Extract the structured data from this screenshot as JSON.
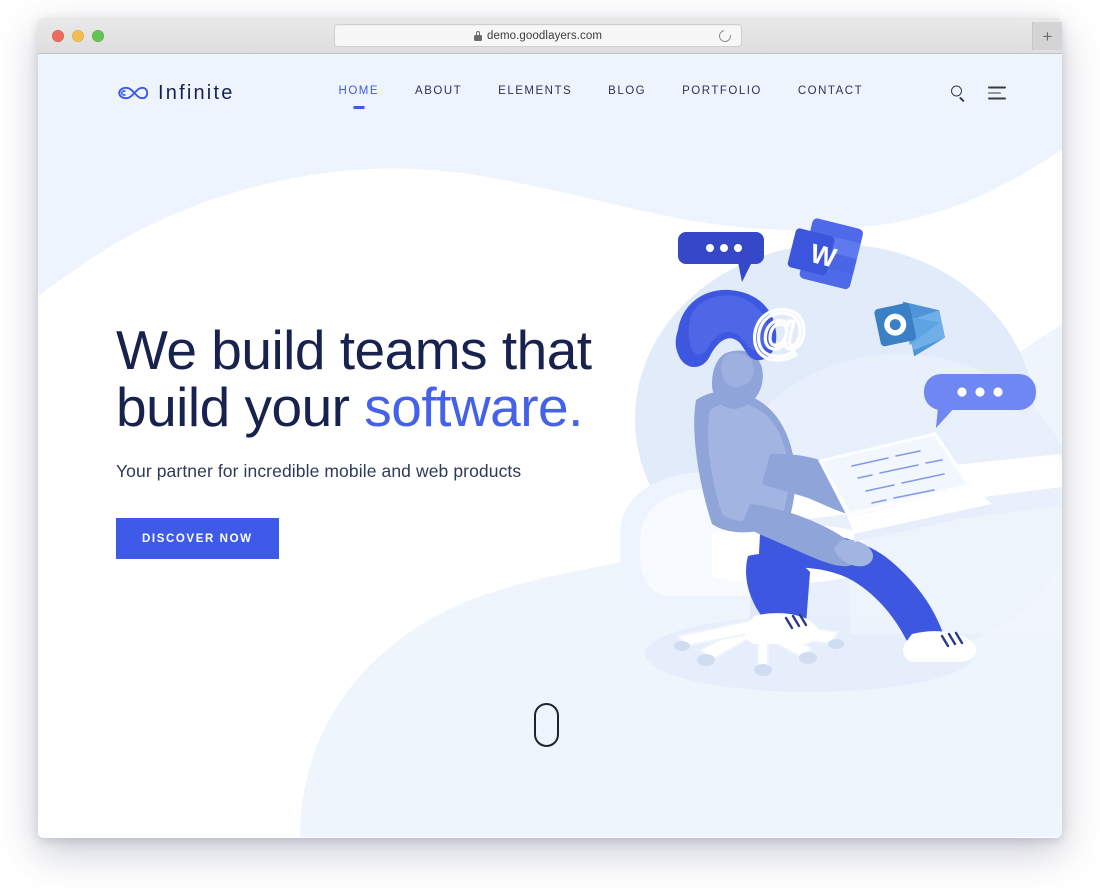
{
  "browser": {
    "url": "demo.goodlayers.com",
    "lock_icon": "lock-icon",
    "reload_icon": "reload-icon",
    "newtab_label": "+",
    "traffic_lights": [
      "close-red",
      "minimize-yellow",
      "maximize-green"
    ]
  },
  "site": {
    "brand": {
      "name": "Infinite",
      "logo_icon": "infinity-logo-icon",
      "logo_color": "#3d5be8",
      "text_color": "#16224d"
    },
    "nav": [
      {
        "label": "HOME",
        "active": true
      },
      {
        "label": "ABOUT",
        "active": false
      },
      {
        "label": "ELEMENTS",
        "active": false
      },
      {
        "label": "BLOG",
        "active": false
      },
      {
        "label": "PORTFOLIO",
        "active": false
      },
      {
        "label": "CONTACT",
        "active": false
      }
    ],
    "tools": {
      "search_icon": "search-icon",
      "menu_icon": "hamburger-menu-icon"
    }
  },
  "hero": {
    "title_line1": "We build teams that",
    "title_line2_plain": "build your ",
    "title_line2_accent": "software.",
    "subtitle": "Your partner for incredible mobile and web products",
    "cta_label": "DISCOVER NOW",
    "accent_color": "#4461ea",
    "button_color": "#3d5be8",
    "heading_color": "#17224f"
  },
  "illustration": {
    "name": "person-at-desk-with-laptop",
    "elements": [
      "speech-bubble-dark",
      "speech-bubble-light",
      "microsoft-word-icon",
      "microsoft-outlook-icon",
      "at-symbol-icon",
      "laptop",
      "office-chair",
      "desk",
      "seated-person"
    ],
    "word_letter": "W",
    "outlook_letter": "O",
    "at_symbol": "@"
  },
  "scroll_indicator": {
    "name": "scroll-down-mouse-indicator"
  },
  "palette": {
    "page_bg": "#ffffff",
    "blob_light": "#eef4fd",
    "blob_soft": "#e3ecfa",
    "accent_blue": "#3d5be8",
    "navy": "#17224f"
  }
}
